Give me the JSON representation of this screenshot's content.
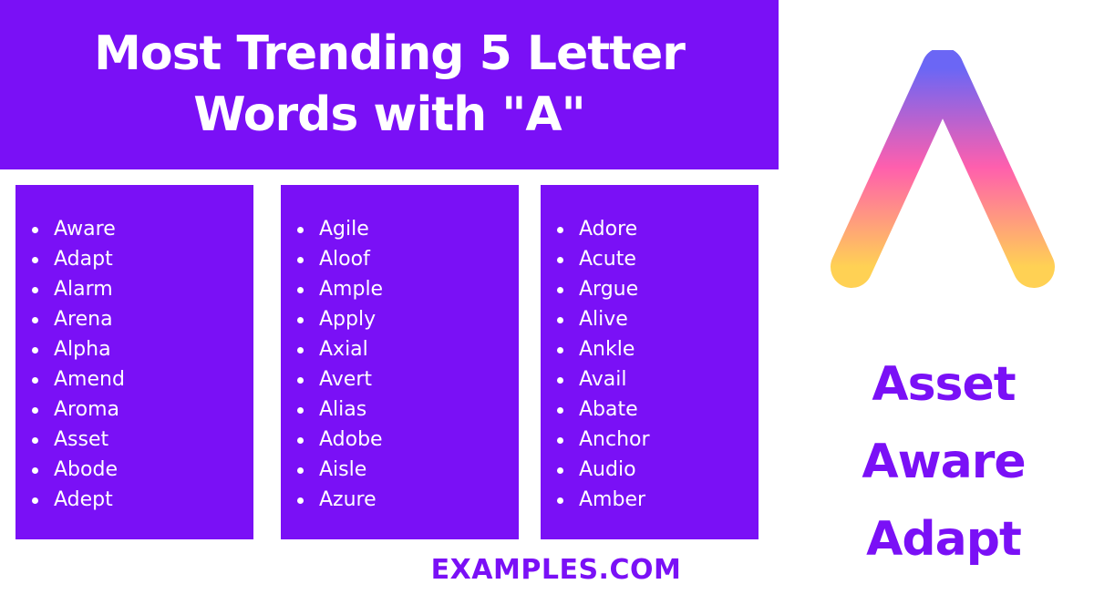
{
  "header": {
    "title_line1": "Most Trending 5 Letter",
    "title_line2": "Words with \"A\""
  },
  "columns": [
    {
      "words": [
        "Aware",
        "Adapt",
        "Alarm",
        "Arena",
        "Alpha",
        "Amend",
        "Aroma",
        "Asset",
        "Abode",
        "Adept"
      ]
    },
    {
      "words": [
        "Agile",
        "Aloof",
        "Ample",
        "Apply",
        "Axial",
        "Avert",
        "Alias",
        "Adobe",
        "Aisle",
        "Azure"
      ]
    },
    {
      "words": [
        "Adore",
        "Acute",
        "Argue",
        "Alive",
        "Ankle",
        "Avail",
        "Abate",
        "Anchor",
        "Audio",
        "Amber"
      ]
    }
  ],
  "featured_words": [
    "Asset",
    "Aware",
    "Adapt"
  ],
  "footer": {
    "brand": "EXAMPLES.COM"
  },
  "logo": {
    "icon": "letter-a-gradient-logo"
  },
  "colors": {
    "primary": "#7a10f6",
    "gradient_top": "#6b66f5",
    "gradient_mid": "#ff5fad",
    "gradient_bottom": "#ffd154"
  }
}
